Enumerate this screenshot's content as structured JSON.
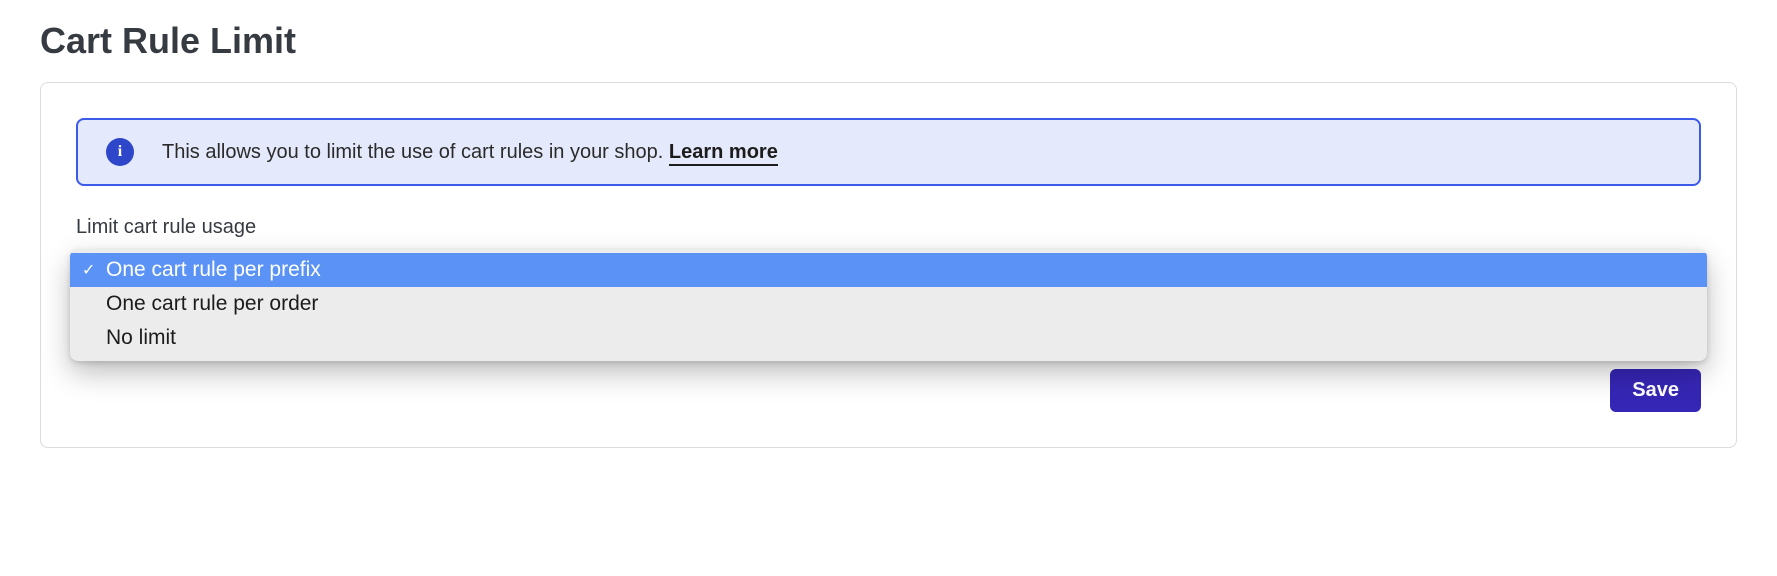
{
  "page": {
    "title": "Cart Rule Limit"
  },
  "info": {
    "message": "This allows you to limit the use of cart rules in your shop. ",
    "learn_more_label": "Learn more"
  },
  "field": {
    "label": "Limit cart rule usage"
  },
  "dropdown": {
    "options": [
      {
        "label": "One cart rule per prefix",
        "selected": true
      },
      {
        "label": "One cart rule per order",
        "selected": false
      },
      {
        "label": "No limit",
        "selected": false
      }
    ]
  },
  "actions": {
    "save_label": "Save"
  }
}
